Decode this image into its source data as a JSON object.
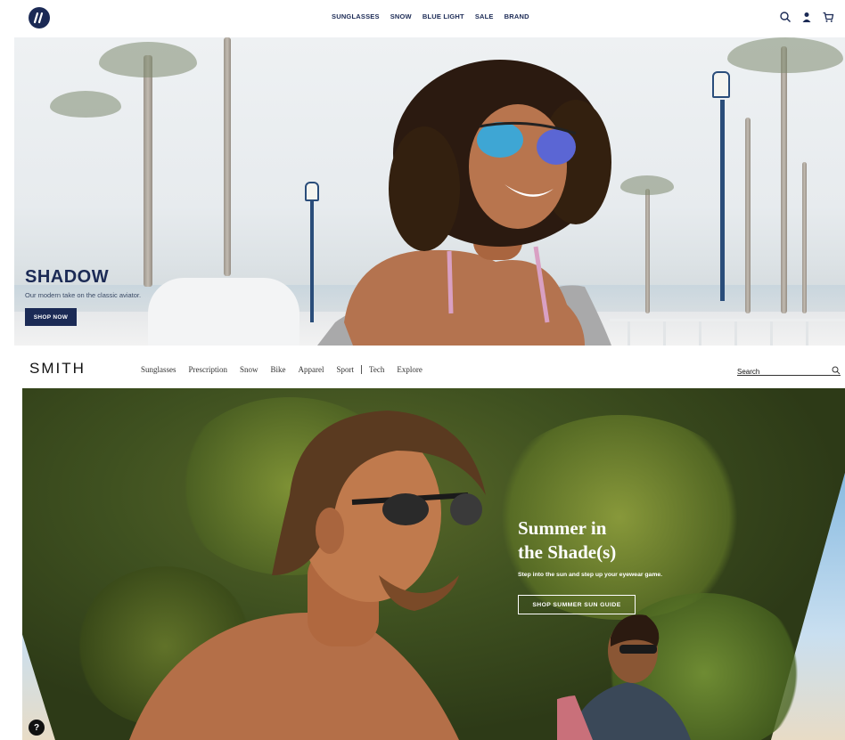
{
  "top_header": {
    "logo_icon": "brand-logo-icon",
    "nav": [
      "SUNGLASSES",
      "SNOW",
      "BLUE LIGHT",
      "SALE",
      "BRAND"
    ],
    "icons": [
      "search-icon",
      "account-icon",
      "cart-icon"
    ]
  },
  "hero1": {
    "title": "SHADOW",
    "subtitle": "Our modern take on the classic aviator.",
    "cta": "SHOP NOW"
  },
  "smith_header": {
    "logo": "SMITH",
    "nav": [
      "Sunglasses",
      "Prescription",
      "Snow",
      "Bike",
      "Apparel",
      "Sport",
      "Tech",
      "Explore"
    ],
    "search_placeholder": "Search"
  },
  "hero2": {
    "title_line1": "Summer in",
    "title_line2": "the Shade(s)",
    "subtitle": "Step into the sun and step up your eyewear game.",
    "cta": "SHOP SUMMER SUN GUIDE"
  },
  "help": {
    "label": "?"
  },
  "colors": {
    "brand_navy": "#1b2a55",
    "white": "#ffffff"
  }
}
